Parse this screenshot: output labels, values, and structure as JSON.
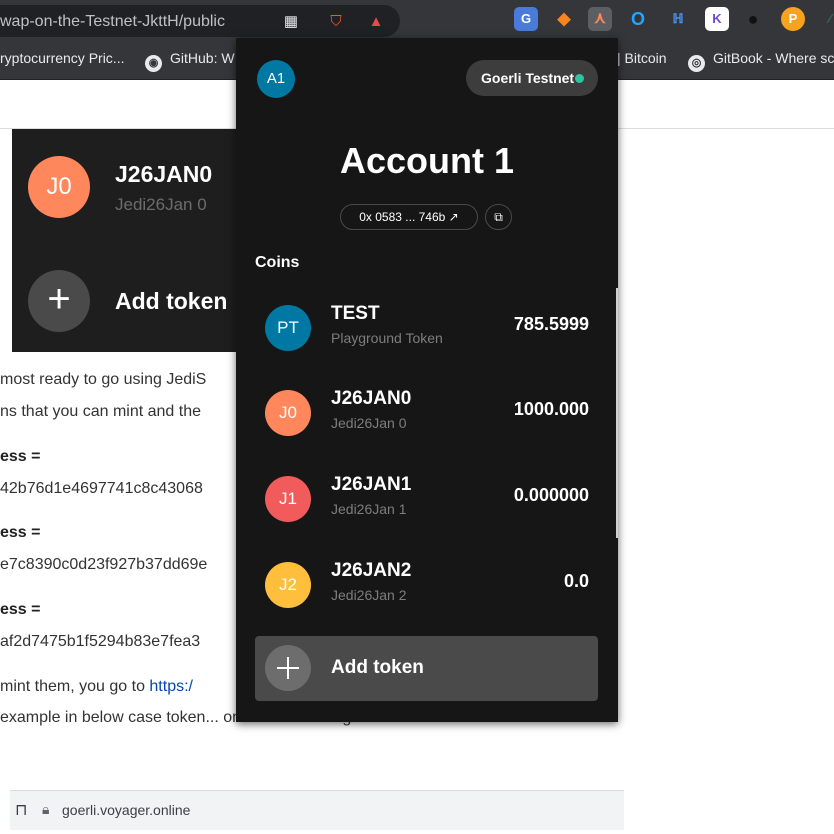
{
  "browser": {
    "url_fragment": "wap-on-the-Testnet-JkttH/public",
    "bookmarks": [
      {
        "label": "ryptocurrency Pric..."
      },
      {
        "label": "GitHub: W"
      },
      {
        "label": "| Bitcoin"
      },
      {
        "label": "GitBook - Where sc"
      }
    ],
    "status_url": "goerli.voyager.online"
  },
  "page": {
    "card": {
      "token_avatar": "J0",
      "token_symbol": "J26JAN0",
      "token_name": "Jedi26Jan 0",
      "add_token": "Add token"
    },
    "paragraphs": [
      "most ready to go using JediS",
      "ns that you can mint and the",
      "ess =",
      "42b76d1e4697741c8c43068",
      "ess =",
      "e7c8390c0d23f927b37dd69e",
      "ess =",
      "af2d7475b1f5294b83e7fea3",
      " mint them, you go to ",
      "example in below case token... on the search engine as it follows:"
    ],
    "link_text": "https:/"
  },
  "wallet": {
    "account_avatar": "A1",
    "network": "Goerli Testnet",
    "account_name": "Account 1",
    "address": "0x 0583 ... 746b",
    "coins_label": "Coins",
    "coins": [
      {
        "avatar": "PT",
        "symbol": "TEST",
        "name": "Playground Token",
        "balance": "785.5999",
        "color": "#0078a4"
      },
      {
        "avatar": "J0",
        "symbol": "J26JAN0",
        "name": "Jedi26Jan 0",
        "balance": "1000.000",
        "color": "#ff875b"
      },
      {
        "avatar": "J1",
        "symbol": "J26JAN1",
        "name": "Jedi26Jan 1",
        "balance": "0.000000",
        "color": "#f15b5b"
      },
      {
        "avatar": "J2",
        "symbol": "J26JAN2",
        "name": "Jedi26Jan 2",
        "balance": "0.0",
        "color": "#ffbf3d"
      }
    ],
    "add_token": "Add token"
  }
}
